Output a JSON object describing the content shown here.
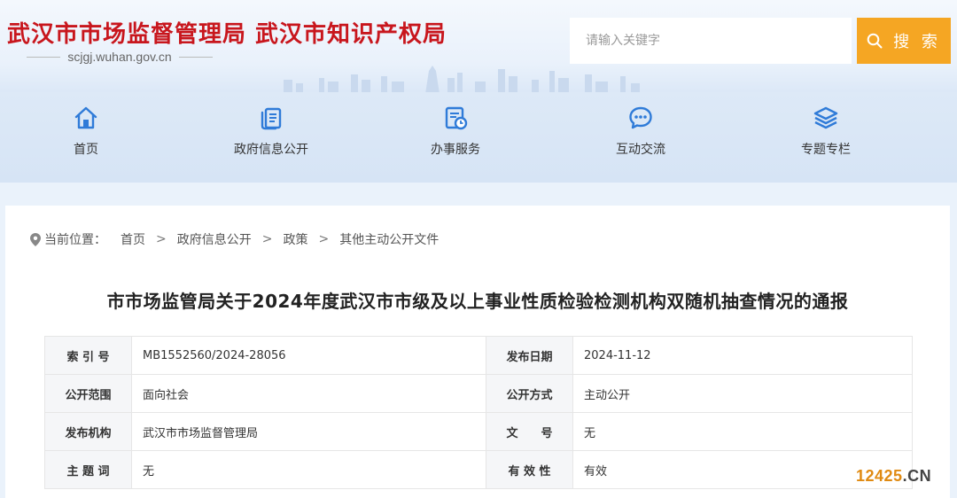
{
  "header": {
    "title": "武汉市市场监督管理局 武汉市知识产权局",
    "domain": "scjgj.wuhan.gov.cn",
    "search_placeholder": "请输入关键字",
    "search_button": "搜 索"
  },
  "nav": {
    "items": [
      {
        "label": "首页",
        "icon": "home-icon"
      },
      {
        "label": "政府信息公开",
        "icon": "document-icon"
      },
      {
        "label": "办事服务",
        "icon": "service-icon"
      },
      {
        "label": "互动交流",
        "icon": "chat-icon"
      },
      {
        "label": "专题专栏",
        "icon": "layers-icon"
      }
    ]
  },
  "breadcrumb": {
    "prefix": "当前位置：",
    "items": [
      "首页",
      "政府信息公开",
      "政策",
      "其他主动公开文件"
    ],
    "separator": ">"
  },
  "article": {
    "title": "市市场监管局关于2024年度武汉市市级及以上事业性质检验检测机构双随机抽查情况的通报"
  },
  "meta": {
    "rows": [
      {
        "k1": "索 引 号",
        "v1": "MB1552560/2024-28056",
        "k2": "发布日期",
        "v2": "2024-11-12"
      },
      {
        "k1": "公开范围",
        "v1": "面向社会",
        "k2": "公开方式",
        "v2": "主动公开"
      },
      {
        "k1": "发布机构",
        "v1": "武汉市市场监督管理局",
        "k2": "文　　号",
        "v2": "无"
      },
      {
        "k1": "主 题 词",
        "v1": "无",
        "k2": "有 效 性",
        "v2": "有效"
      }
    ]
  },
  "watermark": {
    "num": "12425",
    "dot": ".",
    "cn": "CN"
  },
  "colors": {
    "title_red": "#c8161d",
    "search_orange": "#f5a623",
    "icon_blue": "#2f7bd8"
  }
}
